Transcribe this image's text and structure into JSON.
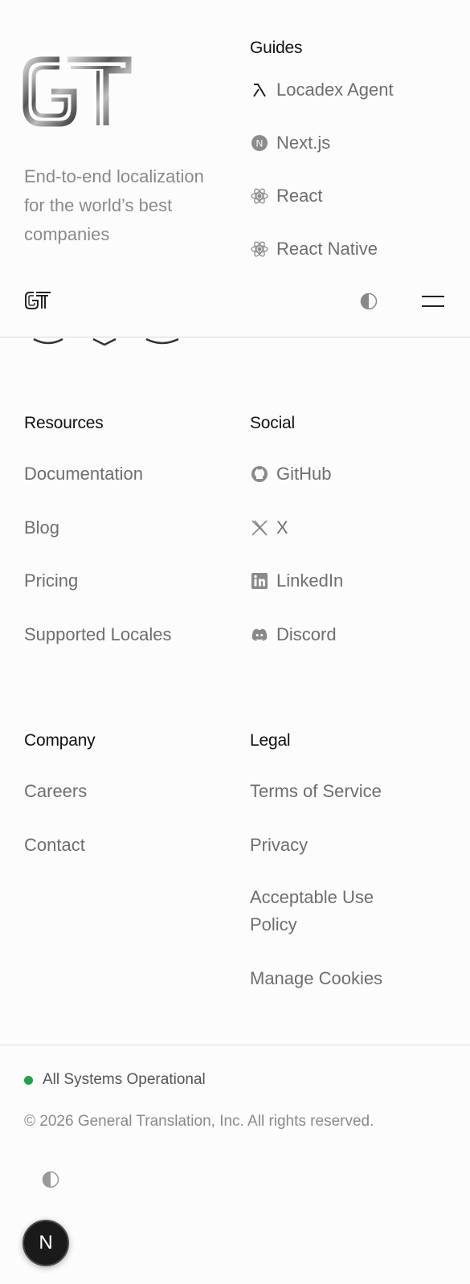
{
  "brand": {
    "tagline": "End-to-end localization for the world’s best companies"
  },
  "guides": {
    "title": "Guides",
    "items": [
      {
        "label": "Locadex Agent",
        "icon": "lambda-icon"
      },
      {
        "label": "Next.js",
        "icon": "nextjs-icon"
      },
      {
        "label": "React",
        "icon": "react-icon"
      },
      {
        "label": "React Native",
        "icon": "react-icon"
      }
    ]
  },
  "resources": {
    "title": "Resources",
    "items": [
      "Documentation",
      "Blog",
      "Pricing",
      "Supported Locales"
    ]
  },
  "social": {
    "title": "Social",
    "items": [
      {
        "label": "GitHub",
        "icon": "github-icon"
      },
      {
        "label": "X",
        "icon": "x-icon"
      },
      {
        "label": "LinkedIn",
        "icon": "linkedin-icon"
      },
      {
        "label": "Discord",
        "icon": "discord-icon"
      }
    ]
  },
  "company": {
    "title": "Company",
    "items": [
      "Careers",
      "Contact"
    ]
  },
  "legal": {
    "title": "Legal",
    "items": [
      "Terms of Service",
      "Privacy",
      "Acceptable Use Policy",
      "Manage Cookies"
    ]
  },
  "footer": {
    "status": "All Systems Operational",
    "status_color": "#22a04b",
    "copyright": "© 2026 General Translation, Inc. All rights reserved."
  },
  "next_badge": {
    "letter": "N"
  }
}
